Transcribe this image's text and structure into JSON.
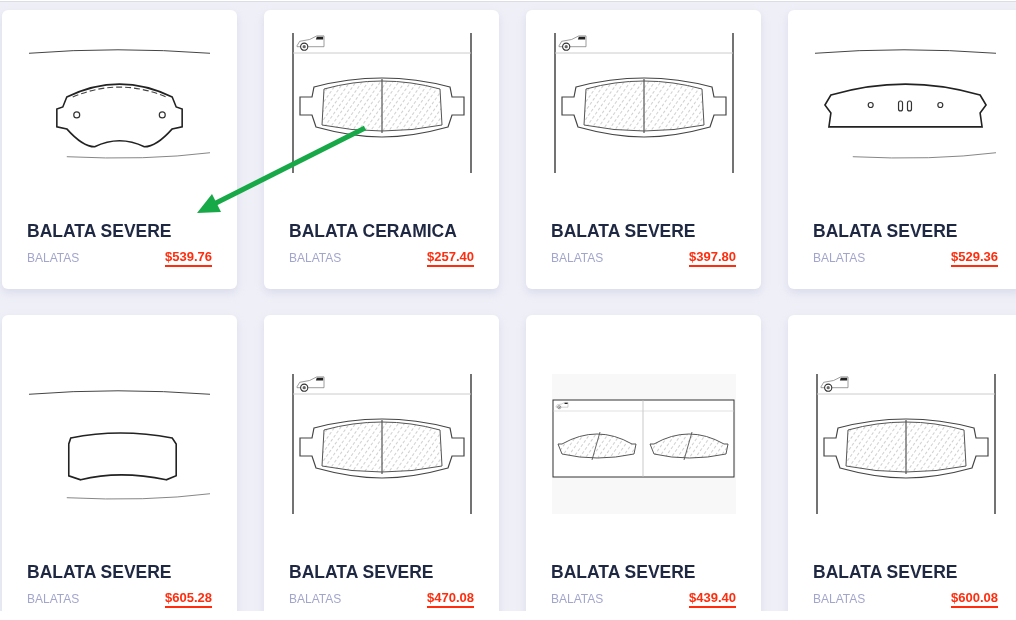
{
  "products": [
    {
      "title": "BALATA SEVERE",
      "category": "BALATAS",
      "price": "$539.76",
      "kind": "outline"
    },
    {
      "title": "BALATA CERAMICA",
      "category": "BALATAS",
      "price": "$257.40",
      "kind": "hatched"
    },
    {
      "title": "BALATA SEVERE",
      "category": "BALATAS",
      "price": "$397.80",
      "kind": "hatched"
    },
    {
      "title": "BALATA SEVERE",
      "category": "BALATAS",
      "price": "$529.36",
      "kind": "outline"
    },
    {
      "title": "BALATA SEVERE",
      "category": "BALATAS",
      "price": "$605.28",
      "kind": "outline"
    },
    {
      "title": "BALATA SEVERE",
      "category": "BALATAS",
      "price": "$470.08",
      "kind": "hatched"
    },
    {
      "title": "BALATA SEVERE",
      "category": "BALATAS",
      "price": "$439.40",
      "kind": "double"
    },
    {
      "title": "BALATA SEVERE",
      "category": "BALATAS",
      "price": "$600.08",
      "kind": "hatched"
    }
  ]
}
